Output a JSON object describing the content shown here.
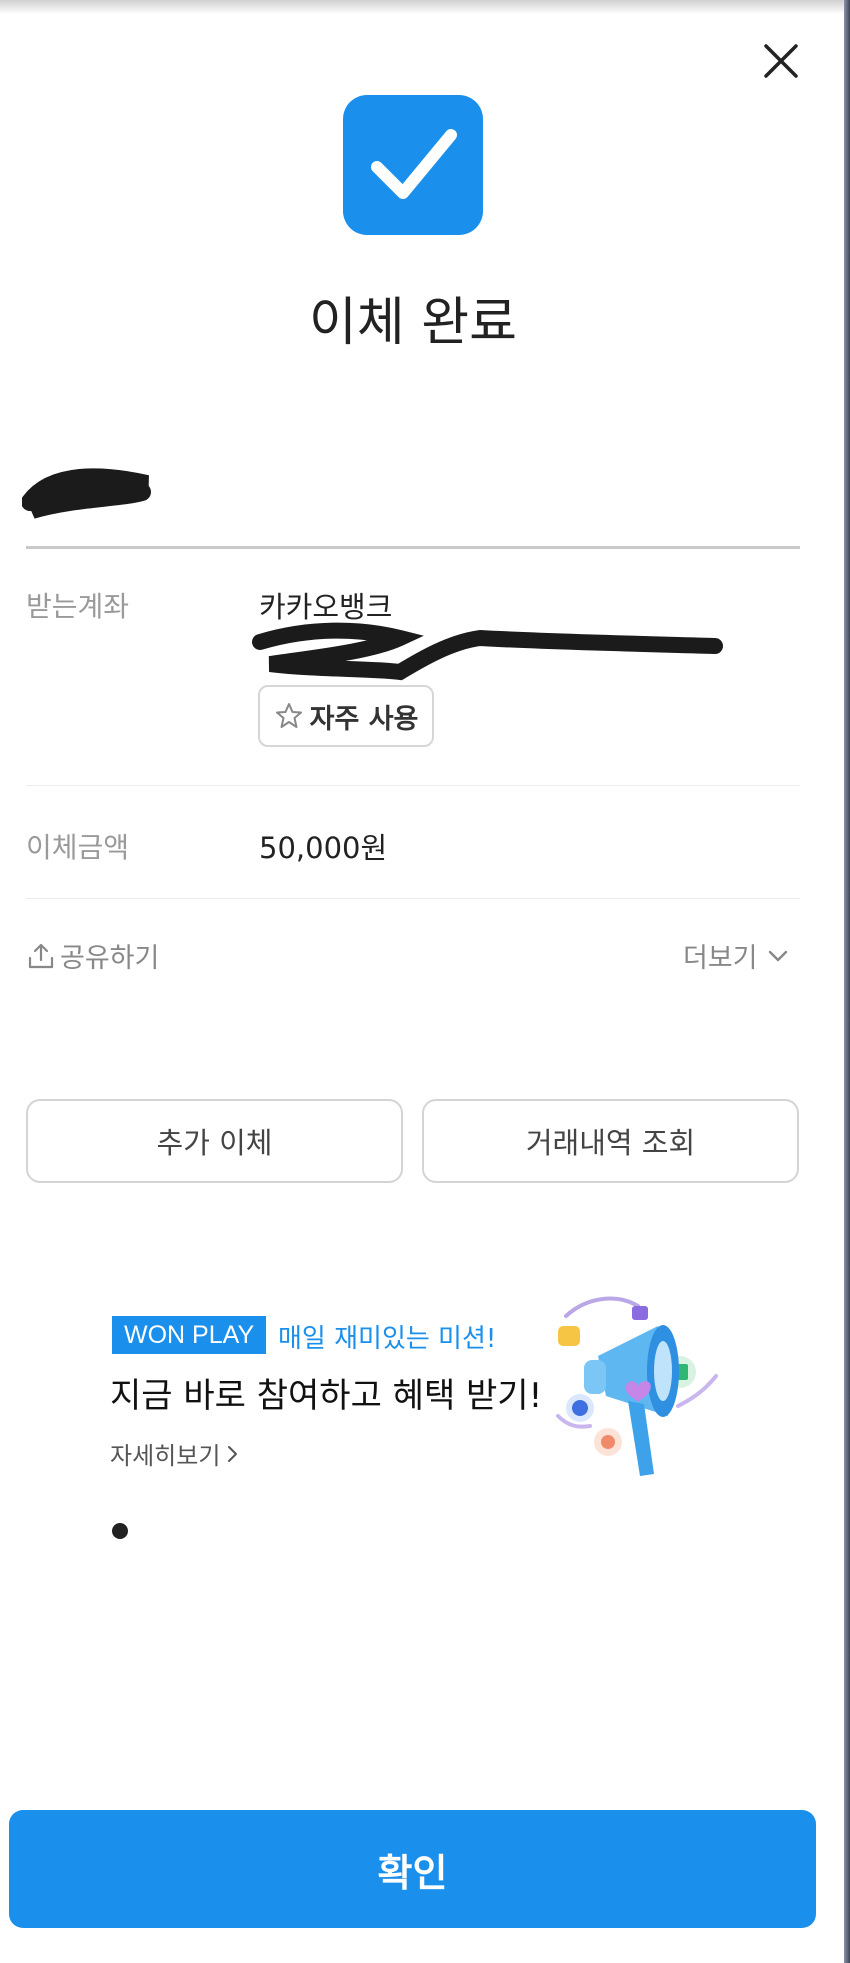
{
  "header": {
    "close_icon": "close-icon"
  },
  "status": {
    "icon": "check-icon",
    "title": "이체 완료",
    "accent": "#1a8fec"
  },
  "details": {
    "account_label": "받는계좌",
    "bank_name": "카카오뱅크",
    "favorite_label": "자주 사용",
    "amount_label": "이체금액",
    "amount_value": "50,000원"
  },
  "links": {
    "share_label": "공유하기",
    "more_label": "더보기"
  },
  "actions": {
    "additional_transfer": "추가 이체",
    "history": "거래내역 조회"
  },
  "banner": {
    "tag": "WON PLAY",
    "subtitle": "매일 재미있는 미션!",
    "title": "지금 바로 참여하고 혜택 받기!",
    "link": "자세히보기"
  },
  "footer": {
    "confirm_label": "확인"
  }
}
